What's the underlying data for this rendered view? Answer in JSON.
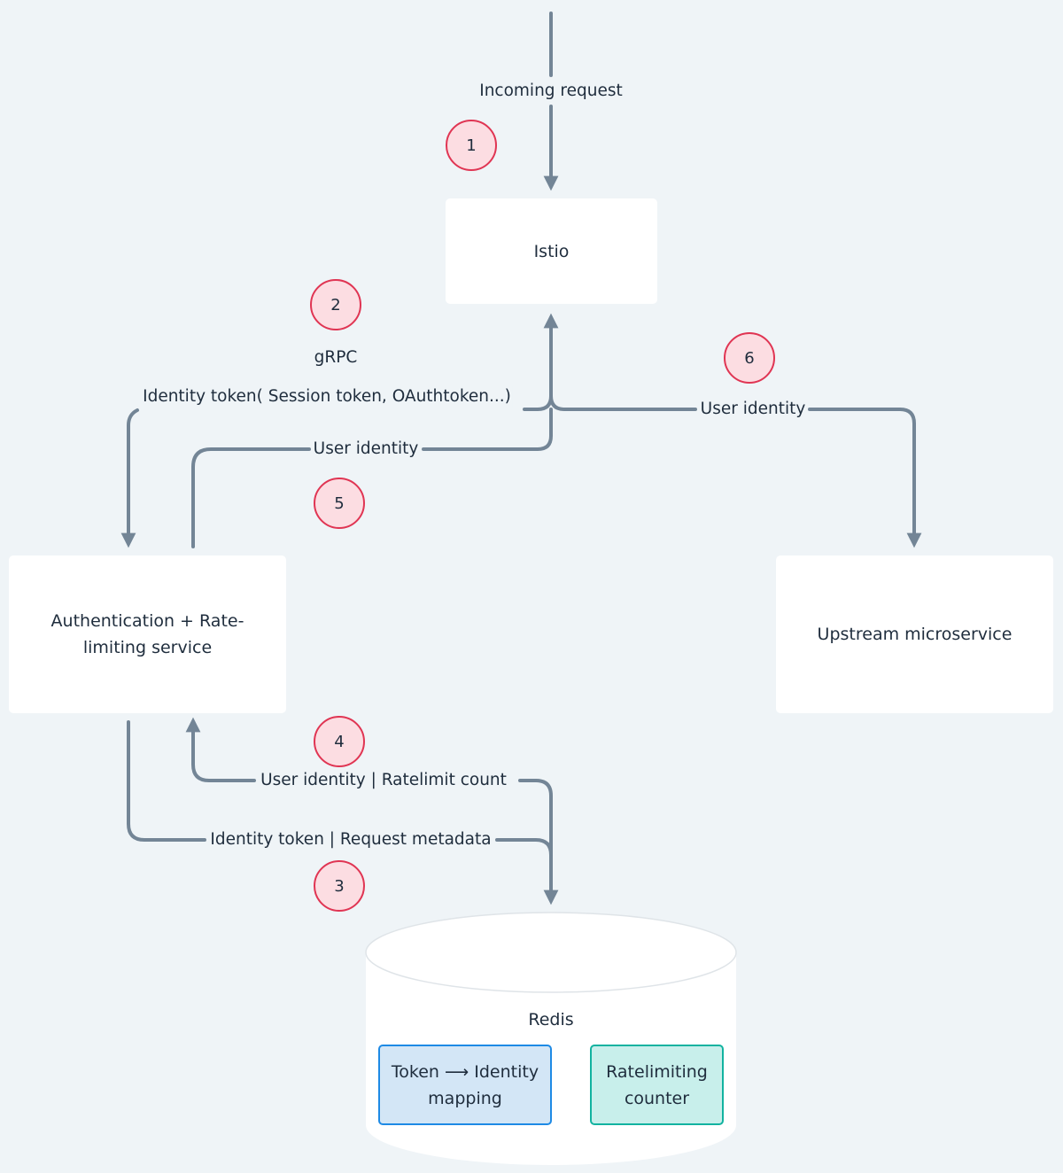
{
  "colors": {
    "background": "#eff4f7",
    "connector": "#738596",
    "badge_fill": "#fcdde2",
    "badge_border": "#e03553",
    "mapping_fill": "#d3e6f6",
    "mapping_border": "#1e8ae5",
    "counter_fill": "#c8efeb",
    "counter_border": "#12b3a0"
  },
  "nodes": {
    "istio": "Istio",
    "auth_service_line1": "Authentication + Rate-",
    "auth_service_line2": "limiting service",
    "upstream": "Upstream microservice",
    "redis": {
      "title": "Redis",
      "mapping_line1": "Token ⟶ Identity",
      "mapping_line2": "mapping",
      "counter_line1": "Ratelimiting",
      "counter_line2": "counter"
    }
  },
  "edge_labels": {
    "incoming": "Incoming request",
    "grpc": "gRPC",
    "identity_token_types": "Identity token( Session token, OAuthtoken...)",
    "user_identity_to_istio": "User identity",
    "user_identity_to_upstream": "User identity",
    "redis_response": "User identity | Ratelimit count",
    "redis_request": "Identity token | Request metadata"
  },
  "steps": [
    "1",
    "2",
    "3",
    "4",
    "5",
    "6"
  ]
}
